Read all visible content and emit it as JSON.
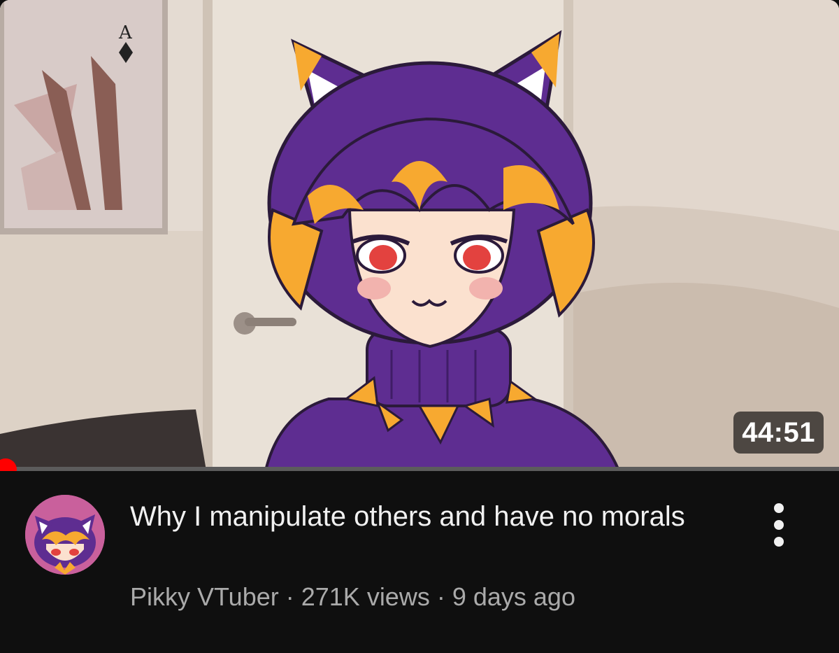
{
  "video": {
    "duration": "44:51",
    "progress_fraction": 0.0,
    "title": "Why I manipulate others and have no morals",
    "channel": "Pikky VTuber",
    "separator": "·",
    "views": "271K views",
    "age": "9 days ago"
  },
  "icons": {
    "menu": "more-vert-icon"
  },
  "colors": {
    "background": "#0f0f0f",
    "title": "#f1f1f1",
    "meta": "#aaaaaa",
    "progress": "#ff0000",
    "avatar_bg": "#c9609c",
    "character_hair": "#5e2d91",
    "character_accent": "#f7a930"
  }
}
